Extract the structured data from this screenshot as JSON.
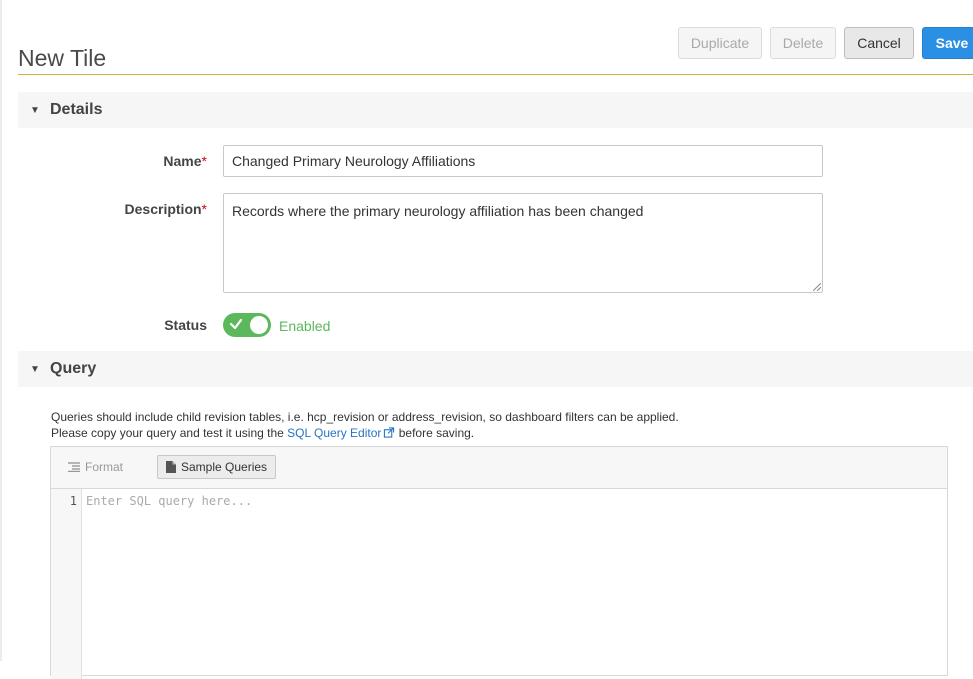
{
  "header": {
    "title": "New Tile",
    "buttons": {
      "duplicate": "Duplicate",
      "delete": "Delete",
      "cancel": "Cancel",
      "save": "Save"
    }
  },
  "details": {
    "section_label": "Details",
    "name_label": "Name",
    "name_value": "Changed Primary Neurology Affiliations",
    "description_label": "Description",
    "description_value": "Records where the primary neurology affiliation has been changed",
    "required_mark": "*",
    "status_label": "Status",
    "status_value": "Enabled",
    "status_enabled": true
  },
  "query": {
    "section_label": "Query",
    "help_line1": "Queries should include child revision tables, i.e. hcp_revision or address_revision, so dashboard filters can be applied.",
    "help_line2_before": "Please copy your query and test it using the ",
    "help_link": "SQL Query Editor",
    "help_line2_after": " before saving.",
    "toolbar": {
      "format_label": "Format",
      "sample_label": "Sample Queries"
    },
    "editor": {
      "line_number": "1",
      "placeholder": "Enter SQL query here..."
    }
  },
  "colors": {
    "primary": "#2b8fe3",
    "accent_rule": "#c9b342",
    "enabled_green": "#5cb85c",
    "required_red": "#d0021b",
    "link": "#2673c5"
  }
}
